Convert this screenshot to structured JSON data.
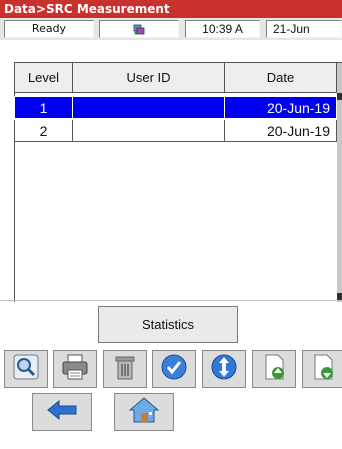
{
  "window": {
    "title": "Data>SRC Measurement"
  },
  "status": {
    "state": "Ready",
    "time": "10:39 A",
    "date": "21-Jun",
    "icon": "network-status-icon"
  },
  "table": {
    "headers": {
      "level": "Level",
      "user_id": "User ID",
      "date": "Date"
    },
    "rows": [
      {
        "level": "1",
        "user_id": "",
        "date": "20-Jun-19",
        "selected": true
      },
      {
        "level": "2",
        "user_id": "",
        "date": "20-Jun-19",
        "selected": false
      }
    ]
  },
  "actions": {
    "statistics_label": "Statistics"
  },
  "toolbar": {
    "buttons": [
      "zoom-icon",
      "printer-icon",
      "trash-icon",
      "check-icon",
      "sort-updown-icon",
      "export-up-icon",
      "import-down-icon"
    ]
  },
  "navigation": {
    "buttons": [
      "back-arrow-icon",
      "home-icon"
    ]
  },
  "colors": {
    "title_bar": "#c8312d",
    "selection": "#0000f0"
  }
}
